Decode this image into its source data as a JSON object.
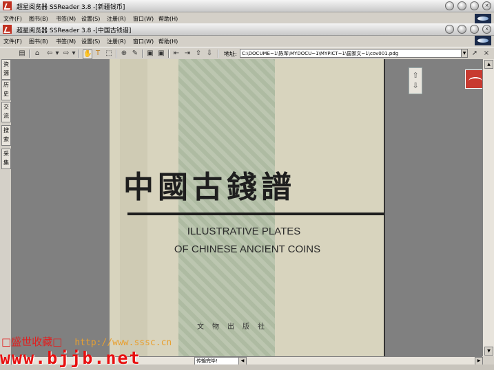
{
  "window1": {
    "title": "超星阅览器 SSReader 3.8 -[新疆钱币]",
    "buttons": [
      "○",
      "○",
      "○",
      "×"
    ]
  },
  "menu1": [
    "文件(F)",
    "图书(B)",
    "书签(M)",
    "设置(S)",
    "注册(R)",
    "窗口(W)",
    "帮助(H)"
  ],
  "window2": {
    "title": "超星阅览器 SSReader 3.8 -[中国古钱谱]",
    "buttons": [
      "○",
      "○",
      "○",
      "×"
    ]
  },
  "menu2": [
    "文件(F)",
    "图书(B)",
    "书签(M)",
    "设置(S)",
    "注册(R)",
    "窗口(W)",
    "帮助(H)"
  ],
  "toolbar": {
    "address_label": "地址:",
    "address_value": "C:\\DOCUME~1\\陈军\\MYDOCU~1\\MYPICT~1\\国家文~1\\cov001.pdg"
  },
  "sidebar": {
    "tabs": [
      "资源",
      "历史",
      "交流",
      "搜索",
      "采集"
    ]
  },
  "page": {
    "title_cn": "中國古錢譜",
    "title_en_line1": "ILLUSTRATIVE PLATES",
    "title_en_line2": "OF CHINESE ANCIENT COINS",
    "publisher": "文物出版社"
  },
  "status": {
    "text": "传输完毕!"
  },
  "watermark": {
    "line1": "□盛世收藏□",
    "line1_url": "http://www.sssc.cn",
    "line2": "www.bjjb.net"
  },
  "icons": [
    "app-icon",
    "hand-icon",
    "text-tool-icon",
    "zoom-icon",
    "arrow-up-icon",
    "arrow-down-icon",
    "back-icon",
    "forward-icon",
    "home-icon"
  ],
  "colors": {
    "watermark_red": "#e81010",
    "title_bg": "#e0e0e0",
    "viewer_bg": "#808080"
  }
}
